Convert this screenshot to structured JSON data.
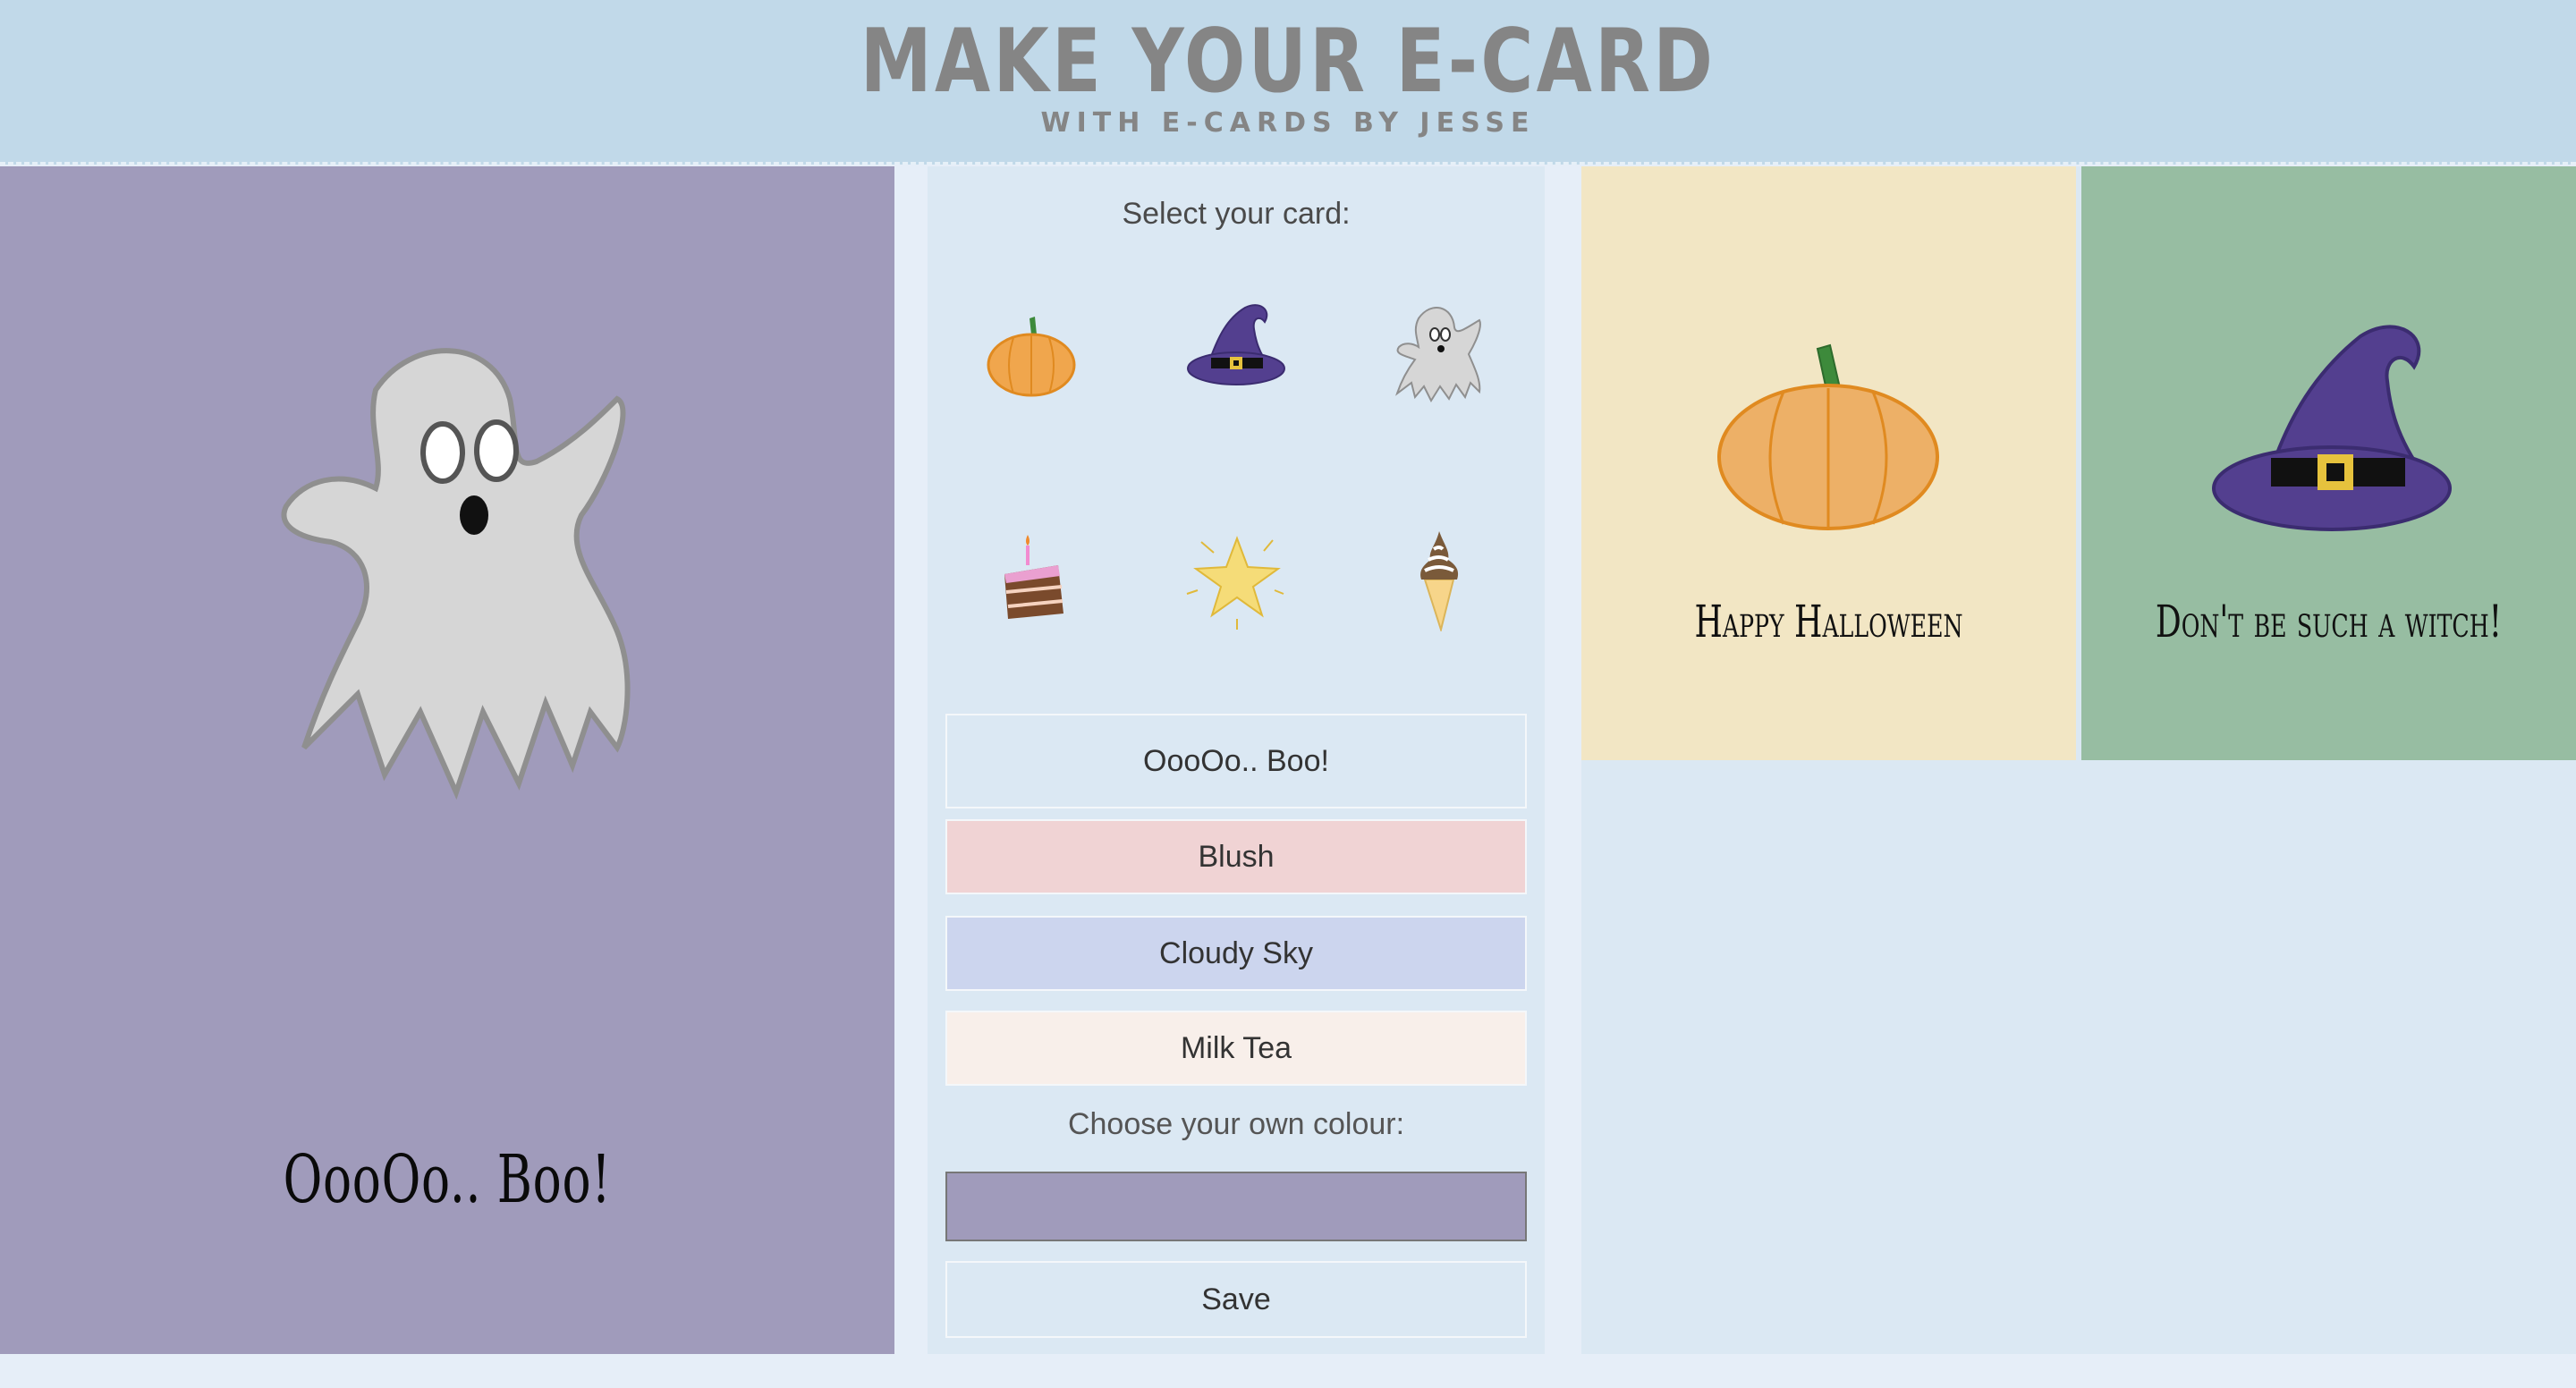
{
  "header": {
    "title": "MAKE YOUR E-CARD",
    "subtitle": "WITH E-CARDS BY JESSE"
  },
  "preview": {
    "background": "#a09bbb",
    "message": "OooOo.. Boo!",
    "image": "ghost-icon"
  },
  "panel": {
    "select_label": "Select your card:",
    "thumbnails": [
      "pumpkin-icon",
      "witch-hat-icon",
      "ghost-icon",
      "cake-icon",
      "star-icon",
      "ice-cream-icon"
    ],
    "options": [
      {
        "label": "OooOo.. Boo!",
        "color": "#dbe8f3"
      },
      {
        "label": "Blush",
        "color": "#f0d3d4"
      },
      {
        "label": "Cloudy Sky",
        "color": "#ccd5ee"
      },
      {
        "label": "Milk Tea",
        "color": "#f8efea"
      }
    ],
    "own_colour_label": "Choose your own colour:",
    "own_colour_value": "#a09bbb",
    "save_label": "Save"
  },
  "gallery": {
    "cards": [
      {
        "title": "Happy Halloween",
        "background": "#f2e6c4",
        "image": "pumpkin-icon"
      },
      {
        "title": "Don't be such a witch!",
        "background": "#97bda2",
        "image": "witch-hat-icon"
      }
    ]
  }
}
